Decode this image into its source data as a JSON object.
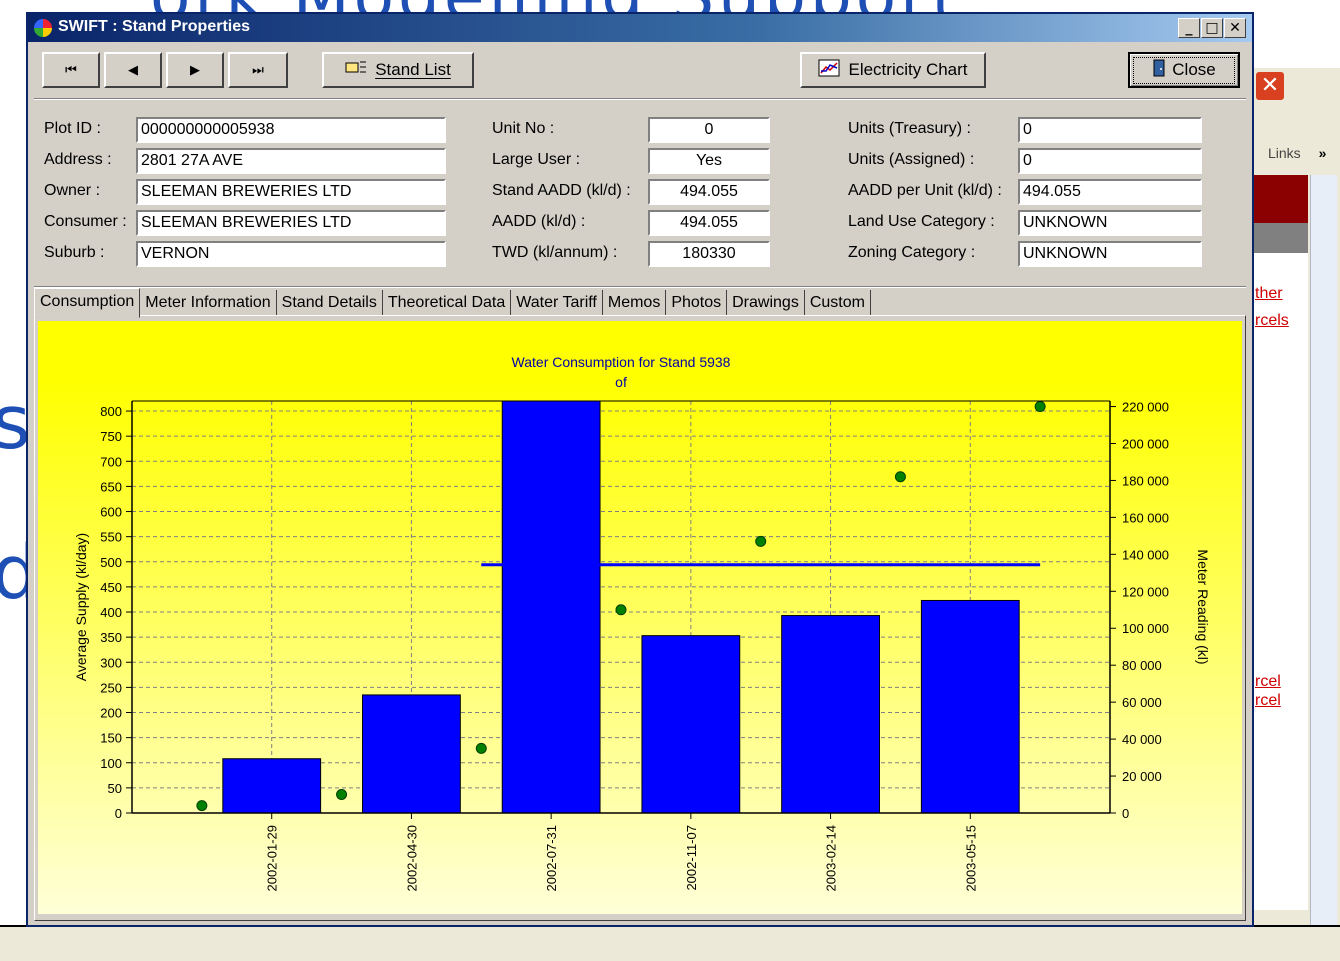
{
  "background": {
    "title_fragment": "ork Modelling Support",
    "big_letter_1": "s",
    "big_letter_2": "d",
    "links_label": "Links",
    "links_chevron": "»",
    "side_links": [
      "ther",
      "rcels",
      "rcel",
      "rcel"
    ],
    "close_glyph": "✕"
  },
  "window": {
    "title": "SWIFT : Stand Properties",
    "minimize": "_",
    "maximize": "□",
    "close": "✕"
  },
  "toolbar": {
    "first": "⏮",
    "prev": "◀",
    "next": "▶",
    "last": "⏭",
    "stand_list": "Stand List",
    "electricity_chart": "Electricity Chart",
    "close": "Close"
  },
  "fields_left": [
    {
      "label": "Plot ID :",
      "value": "000000000005938"
    },
    {
      "label": "Address :",
      "value": "2801 27A AVE"
    },
    {
      "label": "Owner :",
      "value": "SLEEMAN BREWERIES LTD"
    },
    {
      "label": "Consumer :",
      "value": "SLEEMAN BREWERIES LTD"
    },
    {
      "label": "Suburb :",
      "value": "VERNON"
    }
  ],
  "fields_mid": [
    {
      "label": "Unit No :",
      "value": "0"
    },
    {
      "label": "Large User :",
      "value": "Yes"
    },
    {
      "label": "Stand AADD (kl/d) :",
      "value": "494.055"
    },
    {
      "label": "AADD (kl/d) :",
      "value": "494.055"
    },
    {
      "label": "TWD (kl/annum) :",
      "value": "180330"
    }
  ],
  "fields_right": [
    {
      "label": "Units (Treasury) :",
      "value": "0"
    },
    {
      "label": "Units (Assigned) :",
      "value": "0"
    },
    {
      "label": "AADD per Unit (kl/d) :",
      "value": "494.055"
    },
    {
      "label": "Land Use Category :",
      "value": "UNKNOWN"
    },
    {
      "label": "Zoning Category :",
      "value": "UNKNOWN"
    }
  ],
  "tabs": [
    "Consumption",
    "Meter Information",
    "Stand Details",
    "Theoretical Data",
    "Water Tariff",
    "Memos",
    "Photos",
    "Drawings",
    "Custom"
  ],
  "active_tab": 0,
  "chart_data": {
    "type": "bar",
    "title": "Water Consumption for Stand 5938",
    "subtitle": "of",
    "ylabel": "Average Supply (kl/day)",
    "y2label": "Meter Reading (kl)",
    "ylim": [
      0,
      820
    ],
    "y2lim": [
      0,
      223000
    ],
    "yticks": [
      0,
      50,
      100,
      150,
      200,
      250,
      300,
      350,
      400,
      450,
      500,
      550,
      600,
      650,
      700,
      750,
      800
    ],
    "y2ticks": [
      0,
      20000,
      40000,
      60000,
      80000,
      100000,
      120000,
      140000,
      160000,
      180000,
      200000,
      220000
    ],
    "y2tick_labels": [
      "0",
      "20 000",
      "40 000",
      "60 000",
      "80 000",
      "100 000",
      "120 000",
      "140 000",
      "160 000",
      "180 000",
      "200 000",
      "220 000"
    ],
    "categories": [
      "2002-01-29",
      "2002-04-30",
      "2002-07-31",
      "2002-11-07",
      "2003-02-14",
      "2003-05-15"
    ],
    "bar_colors": "#0000ff",
    "series": [
      {
        "type": "bar",
        "axis": "left",
        "values": [
          108,
          235,
          820,
          353,
          393,
          423
        ]
      },
      {
        "type": "line",
        "axis": "left",
        "color": "#0000ff",
        "x_from": 2.5,
        "x_to": 6.5,
        "value": 494.055
      },
      {
        "type": "scatter",
        "axis": "right",
        "color": "#008000",
        "x": [
          0.5,
          1.5,
          2.5,
          3.5,
          4.5,
          5.5,
          6.5
        ],
        "values": [
          4000,
          10000,
          35000,
          110000,
          147000,
          182000,
          220000
        ]
      }
    ],
    "grid": true,
    "grid_style": "dashed"
  }
}
